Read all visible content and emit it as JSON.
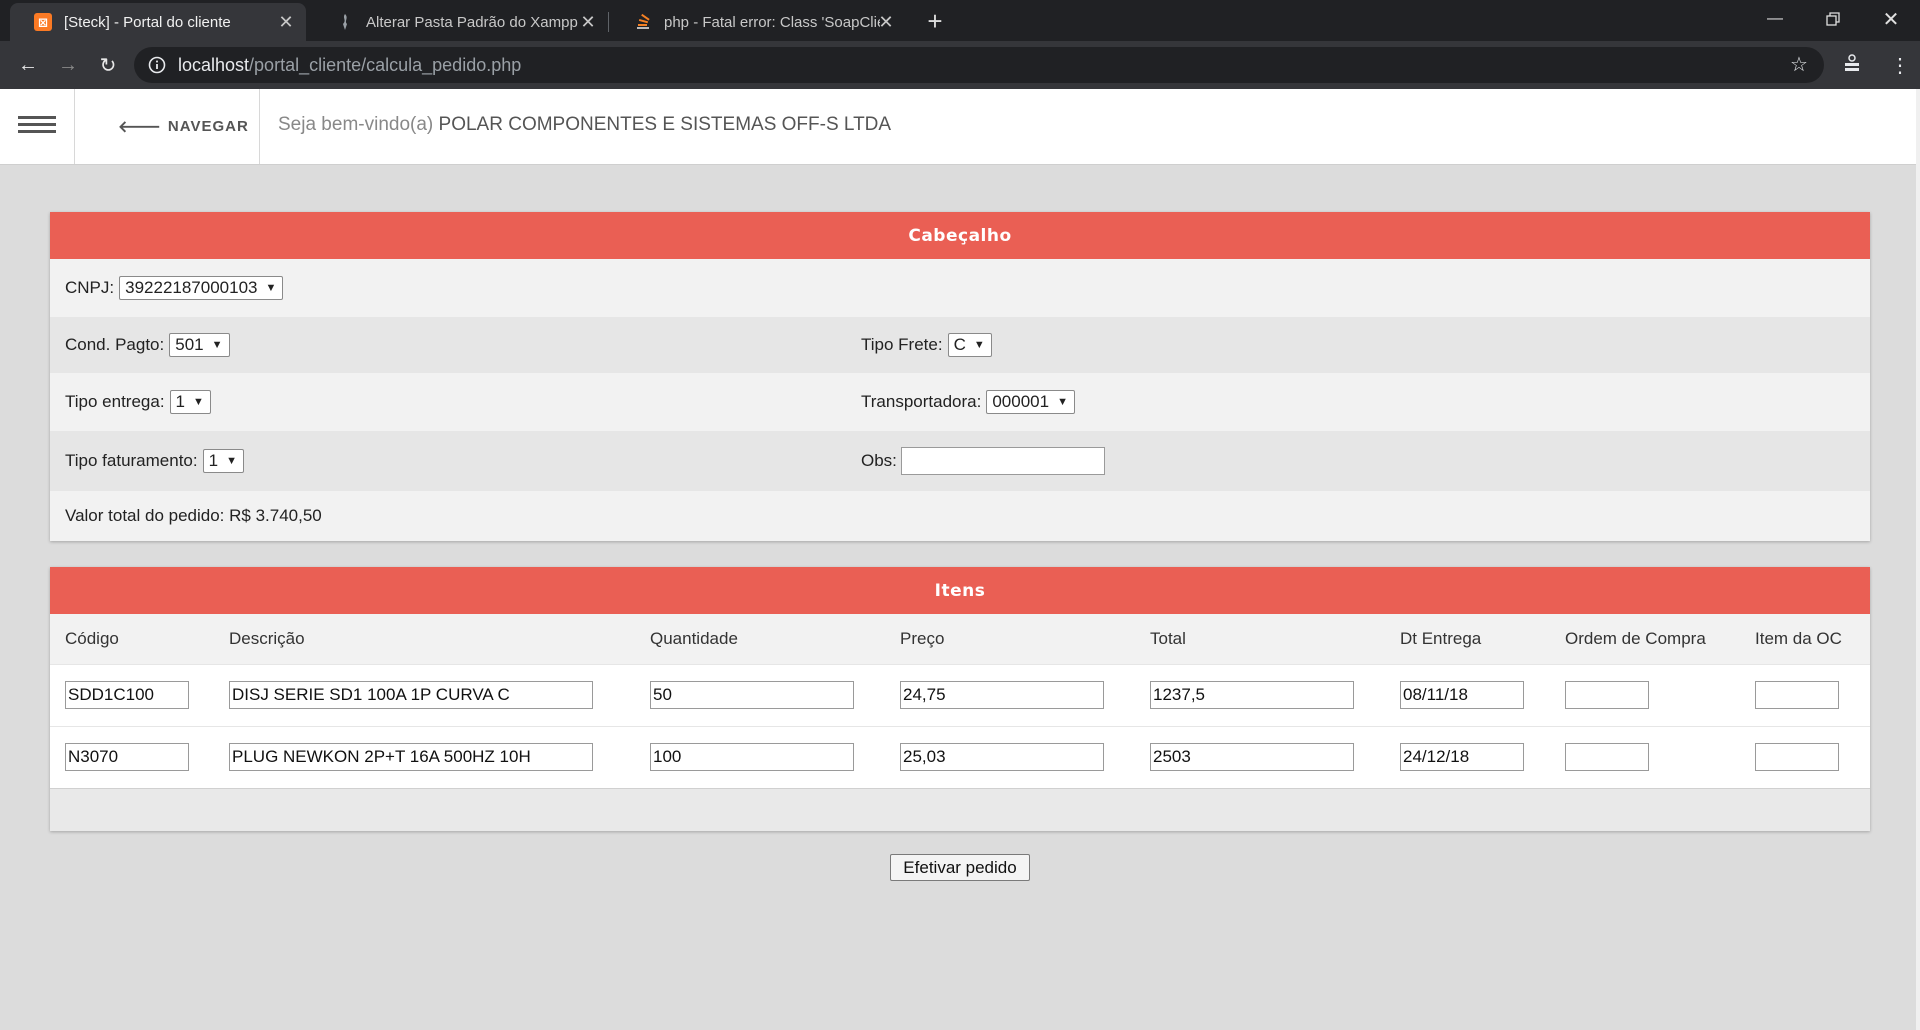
{
  "browser": {
    "tabs": [
      {
        "title": "[Steck] - Portal do cliente",
        "active": true
      },
      {
        "title": "Alterar Pasta Padrão do Xampp",
        "active": false
      },
      {
        "title": "php - Fatal error: Class 'SoapClient'",
        "active": false
      }
    ],
    "url_host": "localhost",
    "url_path": "/portal_cliente/calcula_pedido.php"
  },
  "header": {
    "nav_label": "NAVEGAR",
    "welcome_prefix": "Seja bem-vindo(a) ",
    "company": "POLAR COMPONENTES E SISTEMAS OFF-S LTDA"
  },
  "cabecalho": {
    "title": "Cabeçalho",
    "cnpj": {
      "label": "CNPJ:",
      "value": "39222187000103"
    },
    "cond_pagto": {
      "label": "Cond. Pagto:",
      "value": "501"
    },
    "tipo_frete": {
      "label": "Tipo Frete:",
      "value": "C"
    },
    "tipo_entrega": {
      "label": "Tipo entrega:",
      "value": "1"
    },
    "transportadora": {
      "label": "Transportadora:",
      "value": "000001"
    },
    "tipo_faturamento": {
      "label": "Tipo faturamento:",
      "value": "1"
    },
    "obs": {
      "label": "Obs:",
      "value": ""
    },
    "valor_total": "Valor total do pedido: R$ 3.740,50"
  },
  "itens": {
    "title": "Itens",
    "columns": [
      "Código",
      "Descrição",
      "Quantidade",
      "Preço",
      "Total",
      "Dt Entrega",
      "Ordem de Compra",
      "Item da OC"
    ],
    "rows": [
      {
        "codigo": "SDD1C100",
        "descricao": "DISJ SERIE SD1 100A 1P CURVA C",
        "quantidade": "50",
        "preco": "24,75",
        "total": "1237,5",
        "dt_entrega": "08/11/18",
        "ordem_compra": "",
        "item_oc": ""
      },
      {
        "codigo": "N3070",
        "descricao": "PLUG NEWKON 2P+T 16A 500HZ 10H",
        "quantidade": "100",
        "preco": "25,03",
        "total": "2503",
        "dt_entrega": "24/12/18",
        "ordem_compra": "",
        "item_oc": ""
      }
    ]
  },
  "actions": {
    "submit_label": "Efetivar pedido"
  },
  "colors": {
    "panel_header": "#ea5f54",
    "background": "#dcdcdc"
  }
}
